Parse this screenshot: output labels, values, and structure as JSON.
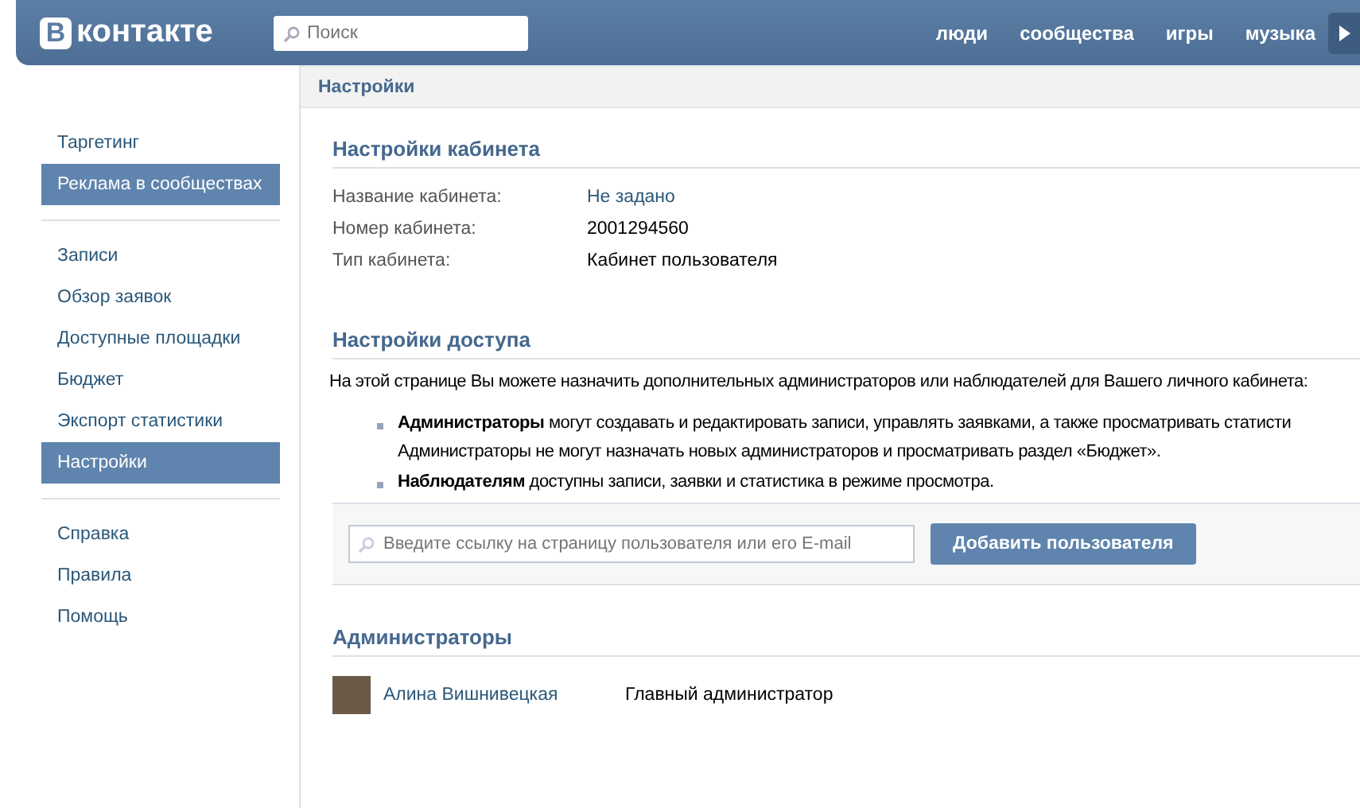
{
  "header": {
    "logo_letter": "В",
    "logo_text": "контакте",
    "search": {
      "placeholder": "Поиск"
    },
    "nav": [
      "люди",
      "сообщества",
      "игры",
      "музыка"
    ]
  },
  "sidebar": {
    "groups": [
      [
        {
          "label": "Таргетинг",
          "selected": false
        },
        {
          "label": "Реклама в сообществах",
          "selected": true
        }
      ],
      [
        {
          "label": "Записи",
          "selected": false
        },
        {
          "label": "Обзор заявок",
          "selected": false
        },
        {
          "label": "Доступные площадки",
          "selected": false
        },
        {
          "label": "Бюджет",
          "selected": false
        },
        {
          "label": "Экспорт статистики",
          "selected": false
        },
        {
          "label": "Настройки",
          "selected": true
        }
      ],
      [
        {
          "label": "Справка",
          "selected": false
        },
        {
          "label": "Правила",
          "selected": false
        },
        {
          "label": "Помощь",
          "selected": false
        }
      ]
    ]
  },
  "page_title": "Настройки",
  "cabinet": {
    "title": "Настройки кабинета",
    "fields": [
      {
        "label": "Название кабинета:",
        "value": "Не задано",
        "kind": "link"
      },
      {
        "label": "Номер кабинета:",
        "value": "2001294560",
        "kind": "text"
      },
      {
        "label": "Тип кабинета:",
        "value": "Кабинет пользователя",
        "kind": "text"
      }
    ]
  },
  "access": {
    "title": "Настройки доступа",
    "intro": "На этой странице Вы можете назначить дополнительных администраторов или наблюдателей для Вашего личного кабинета:",
    "bullets": [
      "**Администраторы** могут создавать и редактировать записи, управлять заявками, а также просматривать статисти",
      "**Наблюдателям** доступны записи, заявки и статистика в режиме просмотра."
    ],
    "bullet_continuation": "Администраторы не могут назначать новых администраторов и просматривать раздел «Бюджет».",
    "input": {
      "placeholder": "Введите ссылку на страницу пользователя или его E-mail"
    },
    "add_button": "Добавить пользователя"
  },
  "admins": {
    "title": "Администраторы",
    "rows": [
      {
        "name": "Алина Вишнивецкая",
        "role": "Главный администратор"
      }
    ]
  }
}
